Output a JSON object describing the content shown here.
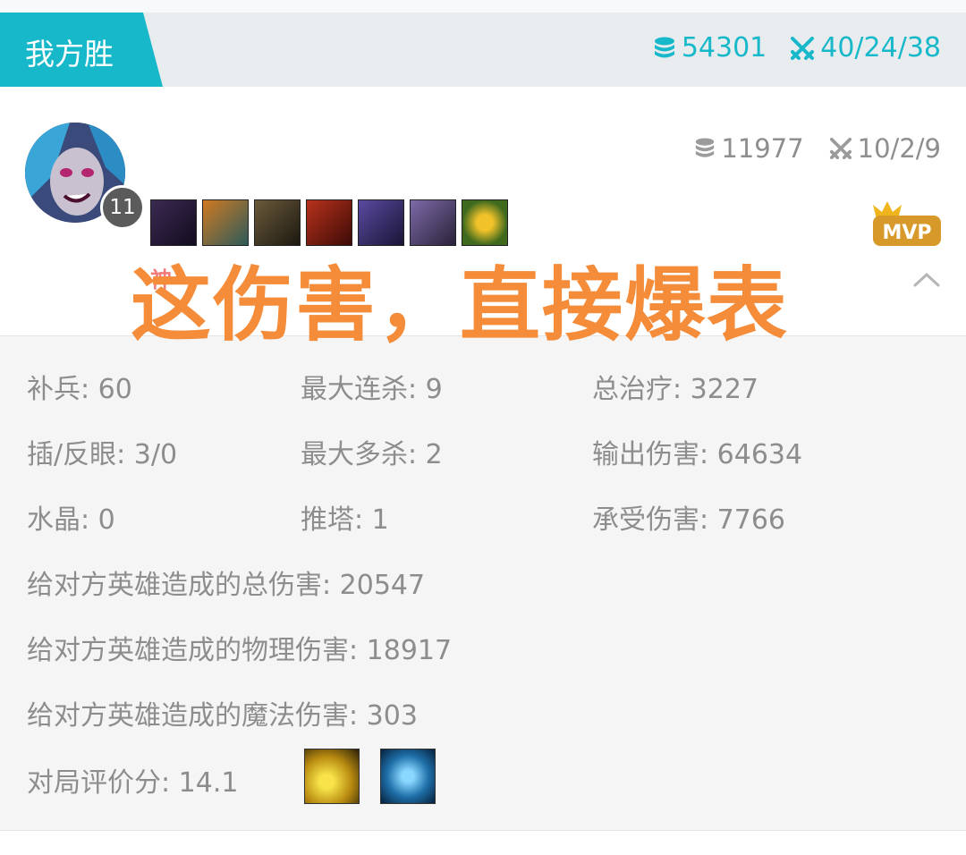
{
  "team": {
    "result_label": "我方胜",
    "gold": "54301",
    "kda": "40/24/38",
    "accent_color": "#17b8c9",
    "gold_icon": "coins-stack-icon",
    "kda_icon": "crossed-swords-icon"
  },
  "player": {
    "level": "11",
    "gold": "11977",
    "kda": "10/2/9",
    "badge": "MVP",
    "items": [
      {
        "name": "dagger-item-icon"
      },
      {
        "name": "runaan-hurricane-item-icon"
      },
      {
        "name": "berserker-greaves-item-icon"
      },
      {
        "name": "navori-quickblades-item-icon"
      },
      {
        "name": "bloodthirster-item-icon"
      },
      {
        "name": "guardian-angel-item-icon"
      },
      {
        "name": "farsight-trinket-item-icon"
      }
    ]
  },
  "overlay": {
    "caption": "这伤害，直接爆表",
    "small": "神"
  },
  "details": {
    "cs": "补兵: 60",
    "largest_killing_spree": "最大连杀: 9",
    "total_heal": "总治疗: 3227",
    "wards": "插/反眼: 3/0",
    "largest_multikill": "最大多杀: 2",
    "damage_dealt": "输出伤害: 64634",
    "crystals": "水晶: 0",
    "towers": "推塔: 1",
    "damage_taken": "承受伤害: 7766",
    "total_champ_damage": "给对方英雄造成的总伤害: 20547",
    "physical_champ_damage": "给对方英雄造成的物理伤害: 18917",
    "magic_champ_damage": "给对方英雄造成的魔法伤害: 303",
    "score": "对局评价分: 14.1",
    "spells": [
      {
        "name": "flash-summoner-spell-icon"
      },
      {
        "name": "ghost-summoner-spell-icon"
      }
    ]
  }
}
